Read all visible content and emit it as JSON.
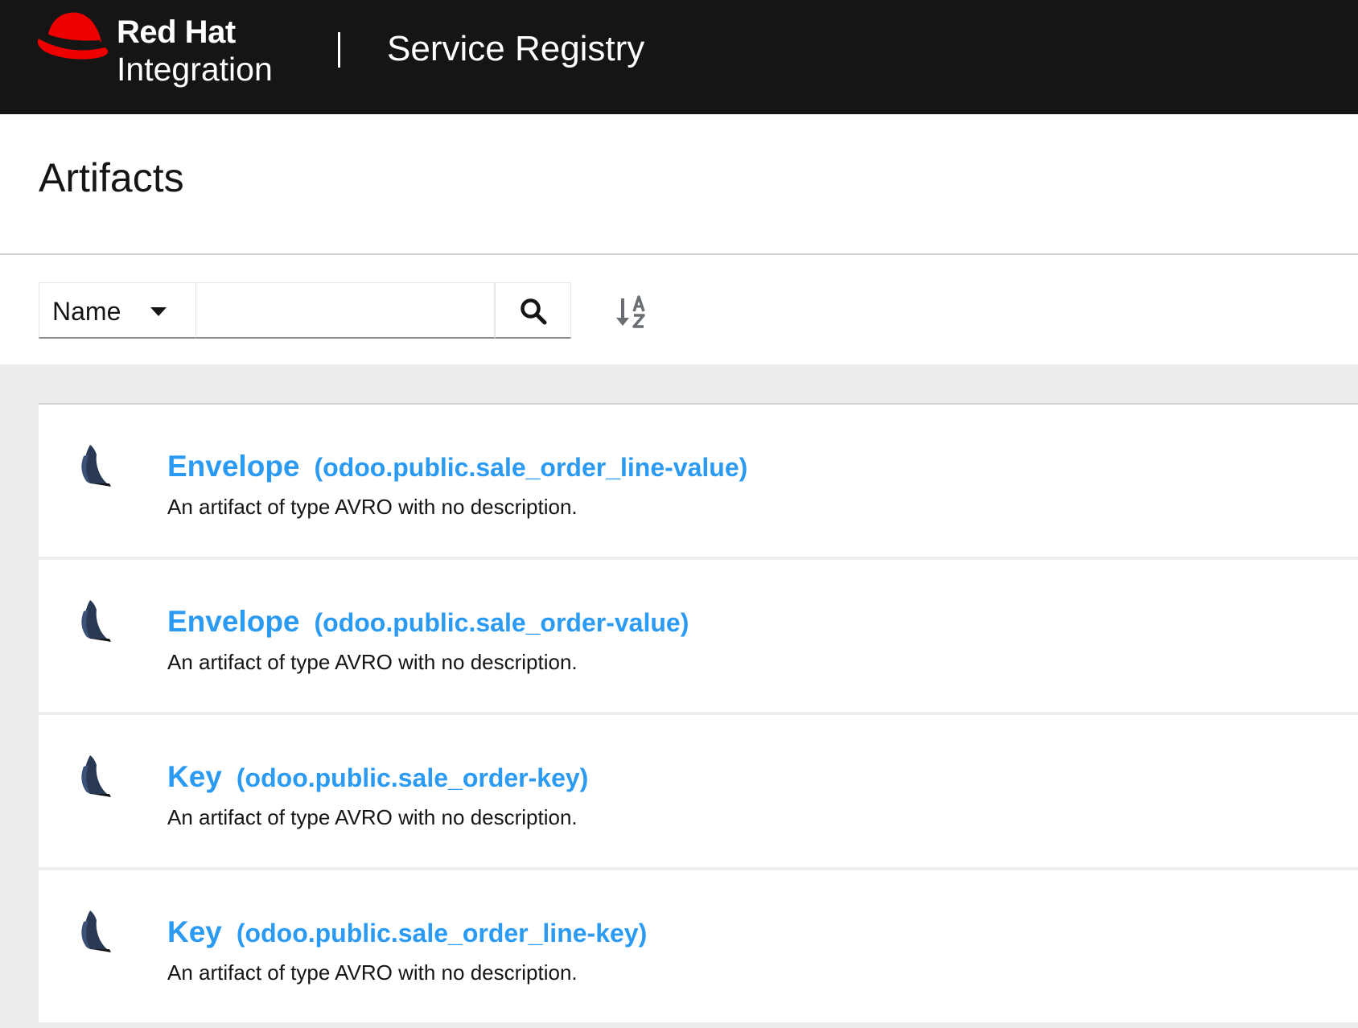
{
  "masthead": {
    "brand_line1": "Red Hat",
    "brand_line2": "Integration",
    "divider": "|",
    "app_title": "Service Registry",
    "brand_color": "#ee0000",
    "background_color": "#151515"
  },
  "page": {
    "title": "Artifacts"
  },
  "toolbar": {
    "filter_field": "Name",
    "search_value": "",
    "search_icon": "search-icon",
    "sort_icon": "sort-alpha-down-icon"
  },
  "artifacts": [
    {
      "name": "Envelope",
      "id": "(odoo.public.sale_order_line-value)",
      "description": "An artifact of type AVRO with no description.",
      "icon": "avro-icon"
    },
    {
      "name": "Envelope",
      "id": "(odoo.public.sale_order-value)",
      "description": "An artifact of type AVRO with no description.",
      "icon": "avro-icon"
    },
    {
      "name": "Key",
      "id": "(odoo.public.sale_order-key)",
      "description": "An artifact of type AVRO with no description.",
      "icon": "avro-icon"
    },
    {
      "name": "Key",
      "id": "(odoo.public.sale_order_line-key)",
      "description": "An artifact of type AVRO with no description.",
      "icon": "avro-icon"
    }
  ],
  "colors": {
    "link": "#2b9af3",
    "list_background": "#ededed",
    "avro_icon": "#293954"
  }
}
